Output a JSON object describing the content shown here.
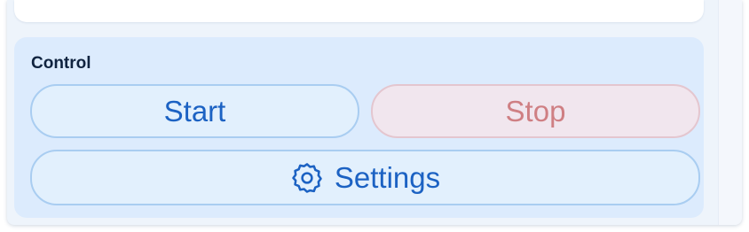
{
  "control": {
    "title": "Control",
    "start_label": "Start",
    "stop_label": "Stop",
    "settings_label": "Settings",
    "settings_icon": "gear-icon"
  },
  "colors": {
    "primary_text": "#1c62c3",
    "stop_text": "#cf7f83",
    "panel_bg": "#dcebfd"
  }
}
